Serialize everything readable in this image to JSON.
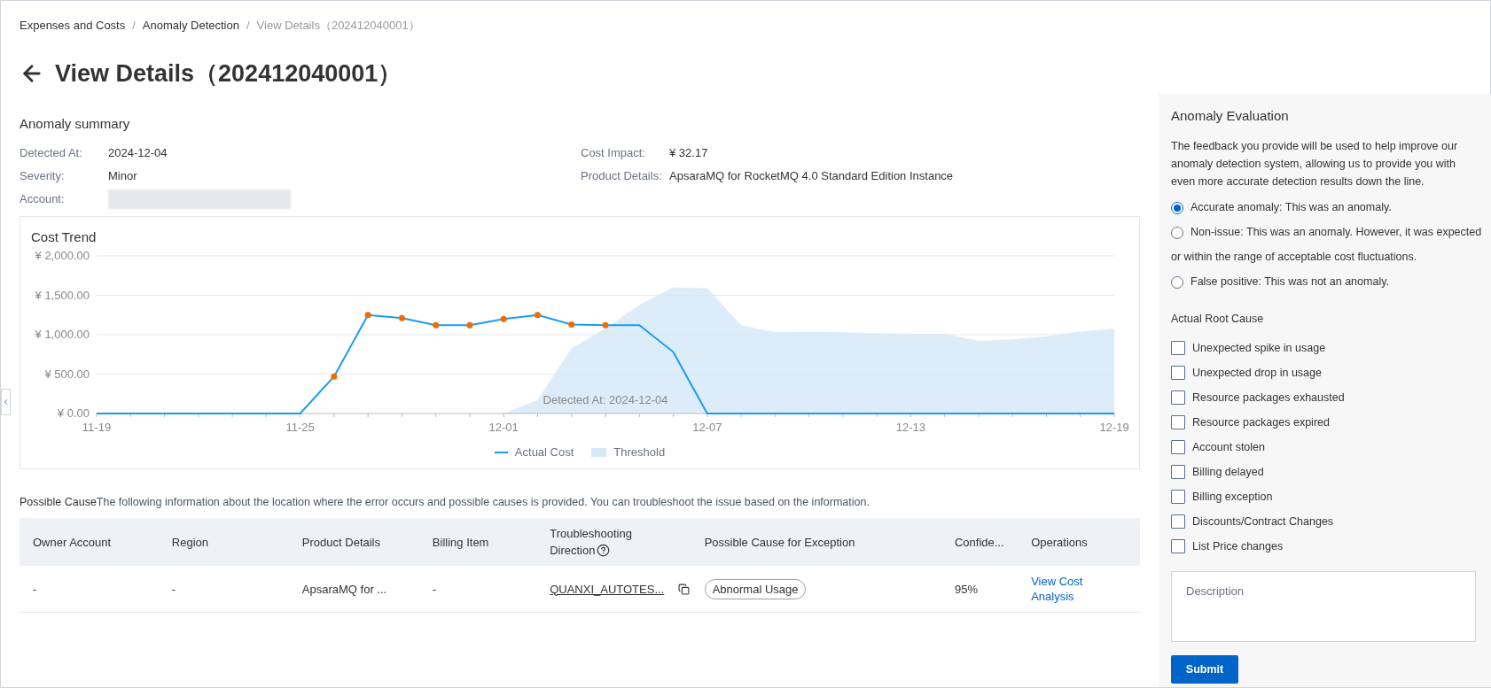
{
  "breadcrumb": [
    {
      "kind": "link",
      "label": "Expenses and Costs",
      "current": false
    },
    {
      "kind": "separator",
      "label": "/"
    },
    {
      "kind": "link",
      "label": "Anomaly Detection",
      "current": false
    },
    {
      "kind": "separator",
      "label": "/"
    },
    {
      "kind": "link",
      "label": "View Details（202412040001）",
      "current": true
    }
  ],
  "title": "View Details（202412040001）",
  "summary": {
    "title": "Anomaly summary",
    "columns": [
      [
        {
          "label": "Detected At:",
          "kind": "text",
          "value": "2024-12-04"
        },
        {
          "label": "Severity:",
          "kind": "text",
          "value": "Minor"
        },
        {
          "label": "Account:",
          "kind": "redacted"
        }
      ],
      [
        {
          "label": "Cost Impact:",
          "kind": "text",
          "value": "¥ 32.17"
        },
        {
          "label": "Product Details:",
          "kind": "text",
          "value": "ApsaraMQ for RocketMQ 4.0 Standard Edition Instance"
        }
      ]
    ]
  },
  "cost_trend": {
    "title": "Cost Trend",
    "chart_data": {
      "type": "line",
      "categories": [
        "11-19",
        null,
        null,
        null,
        null,
        null,
        "11-25",
        null,
        null,
        null,
        null,
        null,
        "12-01",
        null,
        null,
        null,
        null,
        null,
        "12-07",
        null,
        null,
        null,
        null,
        null,
        "12-13",
        null,
        null,
        null,
        null,
        null,
        "12-19"
      ],
      "series": [
        {
          "name": "Actual Cost",
          "type": "line",
          "color": "#1a9bf0",
          "values": [
            0,
            0,
            0,
            0,
            0,
            0,
            0,
            470,
            1250,
            1210,
            1120,
            1120,
            1200,
            1250,
            1130,
            1120,
            1120,
            780,
            0,
            0,
            0,
            0,
            0,
            0,
            0,
            0,
            0,
            0,
            0,
            0,
            0
          ]
        },
        {
          "name": "Threshold",
          "type": "area",
          "color": "#d3e8f8",
          "values": [
            null,
            null,
            null,
            null,
            null,
            null,
            null,
            null,
            null,
            null,
            null,
            null,
            0,
            170,
            830,
            1080,
            1380,
            1600,
            1590,
            1120,
            1030,
            1040,
            1030,
            1020,
            1010,
            1010,
            920,
            940,
            980,
            1040,
            1080
          ]
        }
      ],
      "ylim": [
        0,
        2000
      ],
      "grid": true,
      "yticks": [
        {
          "value": 0,
          "label": "¥ 0.00"
        },
        {
          "value": 500,
          "label": "¥ 500.00"
        },
        {
          "value": 1000,
          "label": "¥ 1,000.00"
        },
        {
          "value": 1500,
          "label": "¥ 1,500.00"
        },
        {
          "value": 2000,
          "label": "¥ 2,000.00"
        }
      ],
      "annotations": [
        "Detected At: 2024-12-04"
      ]
    }
  },
  "possible_cause": {
    "title": "Possible Cause",
    "text": "The following information about the location where the error occurs and possible causes is provided. You can troubleshoot the issue based on the information."
  },
  "table": {
    "columns": [
      {
        "label": "Owner Account",
        "help": false
      },
      {
        "label": "Region",
        "help": false
      },
      {
        "label": "Product Details",
        "help": false
      },
      {
        "label": "Billing Item",
        "help": false
      },
      {
        "label": "Troubleshooting Direction",
        "help": true
      },
      {
        "label": "Possible Cause for Exception",
        "help": false
      },
      {
        "label": "Confide...",
        "help": false
      },
      {
        "label": "Operations",
        "help": false
      }
    ],
    "rows": [
      {
        "cells": [
          {
            "kind": "text",
            "text": "-"
          },
          {
            "kind": "text",
            "text": "-"
          },
          {
            "kind": "text",
            "text": "ApsaraMQ for ..."
          },
          {
            "kind": "text",
            "text": "-"
          },
          {
            "kind": "copy-link",
            "text": "QUANXI_AUTOTES..."
          },
          {
            "kind": "tag",
            "text": "Abnormal Usage"
          },
          {
            "kind": "text",
            "text": "95%"
          },
          {
            "kind": "link",
            "text": "View Cost Analysis"
          }
        ]
      }
    ]
  },
  "evaluation": {
    "title": "Anomaly Evaluation",
    "intro": "The feedback you provide will be used to help improve our anomaly detection system, allowing us to provide you with even more accurate detection results down the line.",
    "options": [
      {
        "label": "Accurate anomaly: This was an anomaly.",
        "selected": true
      },
      {
        "label": "Non-issue: This was an anomaly. However, it was expected",
        "continuation": "or within the range of acceptable cost fluctuations.",
        "selected": false
      },
      {
        "label": "False positive: This was not an anomaly.",
        "selected": false
      }
    ],
    "root_cause_title": "Actual Root Cause",
    "causes": [
      {
        "label": "Unexpected spike in usage",
        "checked": false
      },
      {
        "label": "Unexpected drop in usage",
        "checked": false
      },
      {
        "label": "Resource packages exhausted",
        "checked": false
      },
      {
        "label": "Resource packages expired",
        "checked": false
      },
      {
        "label": "Account stolen",
        "checked": false
      },
      {
        "label": "Billing delayed",
        "checked": false
      },
      {
        "label": "Billing exception",
        "checked": false
      },
      {
        "label": "Discounts/Contract Changes",
        "checked": false
      },
      {
        "label": "List Price changes",
        "checked": false
      }
    ],
    "description": {
      "placeholder": "Description"
    },
    "submit": "Submit"
  }
}
